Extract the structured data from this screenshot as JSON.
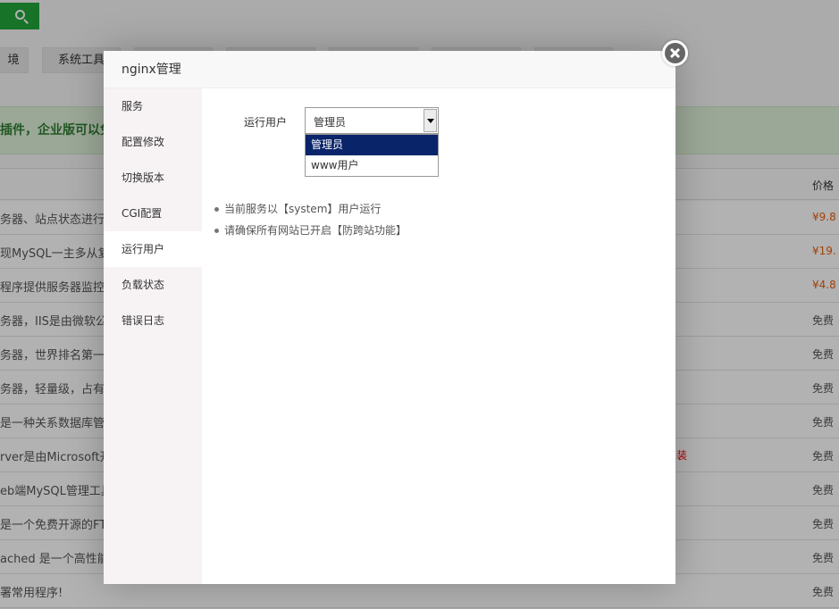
{
  "background": {
    "tabs": [
      "境",
      "系统工具",
      "",
      "",
      "",
      "",
      ""
    ],
    "notice": "插件，企业版可以免",
    "price_header": "价格",
    "rows": [
      {
        "desc": "务器、站点状态进行监",
        "price": "¥9.8",
        "type": "paid",
        "action": ""
      },
      {
        "desc": "现MySQL一主多从复制",
        "price": "¥19.",
        "type": "paid",
        "action": ""
      },
      {
        "desc": "程序提供服务器监控及",
        "price": "¥4.8",
        "type": "paid",
        "action": ""
      },
      {
        "desc": "务器，IIS是由微软公司",
        "price": "免费",
        "type": "free",
        "action": ""
      },
      {
        "desc": "务器，世界排名第一，",
        "price": "免费",
        "type": "free",
        "action": ""
      },
      {
        "desc": "务器，轻量级，占有内",
        "price": "免费",
        "type": "free",
        "action": ""
      },
      {
        "desc": "是一种关系数据库管理",
        "price": "免费",
        "type": "free",
        "action": ""
      },
      {
        "desc": "rver是由Microsoft开",
        "price": "免费",
        "type": "free",
        "action": "装"
      },
      {
        "desc": "eb端MySQL管理工具",
        "price": "免费",
        "type": "free",
        "action": ""
      },
      {
        "desc": "是一个免费开源的FTP",
        "price": "免费",
        "type": "free",
        "action": ""
      },
      {
        "desc": "ached 是一个高性能的",
        "price": "免费",
        "type": "free",
        "action": ""
      },
      {
        "desc": "署常用程序!",
        "price": "免费",
        "type": "free",
        "action": ""
      }
    ]
  },
  "modal": {
    "title": "nginx管理",
    "menu": [
      {
        "label": "服务",
        "active": false
      },
      {
        "label": "配置修改",
        "active": false
      },
      {
        "label": "切换版本",
        "active": false
      },
      {
        "label": "CGI配置",
        "active": false
      },
      {
        "label": "运行用户",
        "active": true
      },
      {
        "label": "负载状态",
        "active": false
      },
      {
        "label": "错误日志",
        "active": false
      }
    ],
    "run_user": {
      "label": "运行用户",
      "selected": "管理员",
      "options": [
        "管理员",
        "www用户"
      ]
    },
    "tips": [
      "当前服务以【system】用户运行",
      "请确保所有网站已开启【防跨站功能】"
    ]
  },
  "colors": {
    "accent_green": "#20a53a",
    "price_orange": "#e85d0b",
    "selected_option": "#0a246a"
  }
}
